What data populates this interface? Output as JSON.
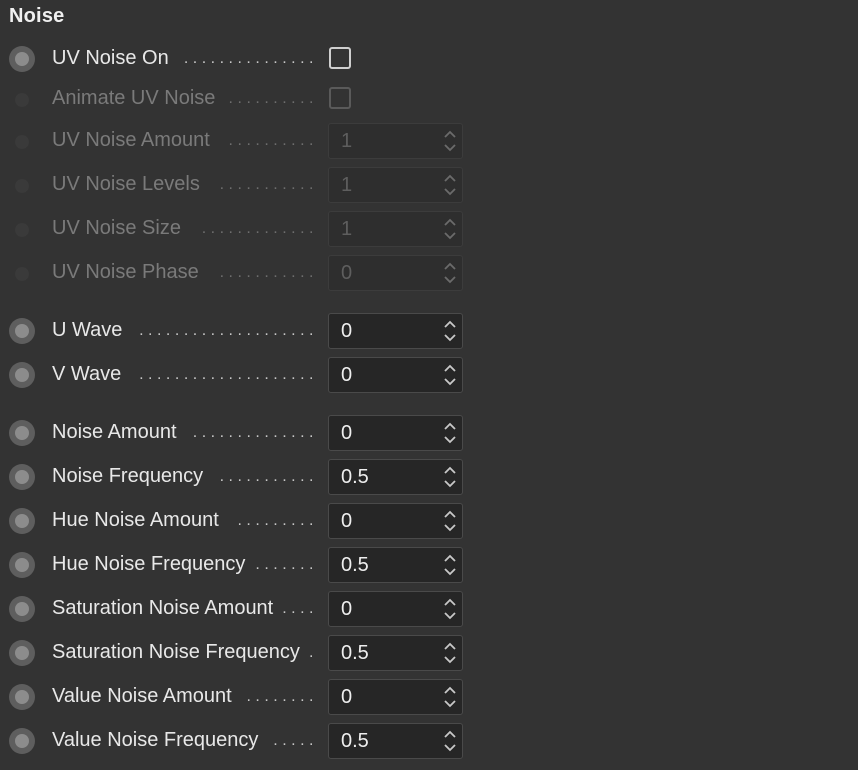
{
  "section": {
    "title": "Noise"
  },
  "colors": {
    "background": "#333333",
    "field_bg": "#262626",
    "text": "#e8e8e8",
    "disabled_text": "#7a7a7a"
  },
  "rows": [
    {
      "id": "uv-noise-on",
      "label": "UV Noise On",
      "type": "checkbox",
      "checked": false,
      "enabled": true
    },
    {
      "id": "animate-uv-noise",
      "label": "Animate UV Noise",
      "type": "checkbox",
      "checked": false,
      "enabled": false
    },
    {
      "id": "uv-noise-amount",
      "label": "UV Noise Amount",
      "type": "number",
      "value": "1",
      "enabled": false
    },
    {
      "id": "uv-noise-levels",
      "label": "UV Noise Levels",
      "type": "number",
      "value": "1",
      "enabled": false
    },
    {
      "id": "uv-noise-size",
      "label": "UV Noise Size",
      "type": "number",
      "value": "1",
      "enabled": false
    },
    {
      "id": "uv-noise-phase",
      "label": "UV Noise Phase",
      "type": "number",
      "value": "0",
      "enabled": false
    },
    {
      "id": "u-wave",
      "label": "U Wave",
      "type": "number",
      "value": "0",
      "enabled": true
    },
    {
      "id": "v-wave",
      "label": "V Wave",
      "type": "number",
      "value": "0",
      "enabled": true
    },
    {
      "id": "noise-amount",
      "label": "Noise Amount",
      "type": "number",
      "value": "0",
      "enabled": true
    },
    {
      "id": "noise-frequency",
      "label": "Noise Frequency",
      "type": "number",
      "value": "0.5",
      "enabled": true
    },
    {
      "id": "hue-noise-amount",
      "label": "Hue Noise Amount",
      "type": "number",
      "value": "0",
      "enabled": true
    },
    {
      "id": "hue-noise-frequency",
      "label": "Hue Noise Frequency",
      "type": "number",
      "value": "0.5",
      "enabled": true
    },
    {
      "id": "saturation-noise-amount",
      "label": "Saturation Noise Amount",
      "type": "number",
      "value": "0",
      "enabled": true
    },
    {
      "id": "saturation-noise-frequency",
      "label": "Saturation Noise Frequency",
      "type": "number",
      "value": "0.5",
      "enabled": true
    },
    {
      "id": "value-noise-amount",
      "label": "Value Noise Amount",
      "type": "number",
      "value": "0",
      "enabled": true
    },
    {
      "id": "value-noise-frequency",
      "label": "Value Noise Frequency",
      "type": "number",
      "value": "0.5",
      "enabled": true
    }
  ]
}
